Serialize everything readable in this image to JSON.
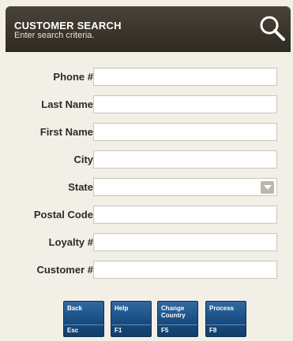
{
  "header": {
    "title": "CUSTOMER SEARCH",
    "subtitle": "Enter search criteria.",
    "icon": "search-icon"
  },
  "form": {
    "fields": [
      {
        "label": "Phone #",
        "value": "",
        "type": "text"
      },
      {
        "label": "Last Name",
        "value": "",
        "type": "text"
      },
      {
        "label": "First Name",
        "value": "",
        "type": "text"
      },
      {
        "label": "City",
        "value": "",
        "type": "text"
      },
      {
        "label": "State",
        "value": "",
        "type": "select"
      },
      {
        "label": "Postal Code",
        "value": "",
        "type": "text"
      },
      {
        "label": "Loyalty #",
        "value": "",
        "type": "text"
      },
      {
        "label": "Customer #",
        "value": "",
        "type": "text"
      }
    ]
  },
  "function_keys": [
    {
      "label": "Back",
      "key": "Esc"
    },
    {
      "label": "Help",
      "key": "F1"
    },
    {
      "label": "Change Country",
      "key": "F5"
    },
    {
      "label": "Process",
      "key": "F8"
    }
  ],
  "colors": {
    "header_bg": "#3a342b",
    "button_bg": "#1f5a93",
    "page_bg": "#f2efe6"
  }
}
